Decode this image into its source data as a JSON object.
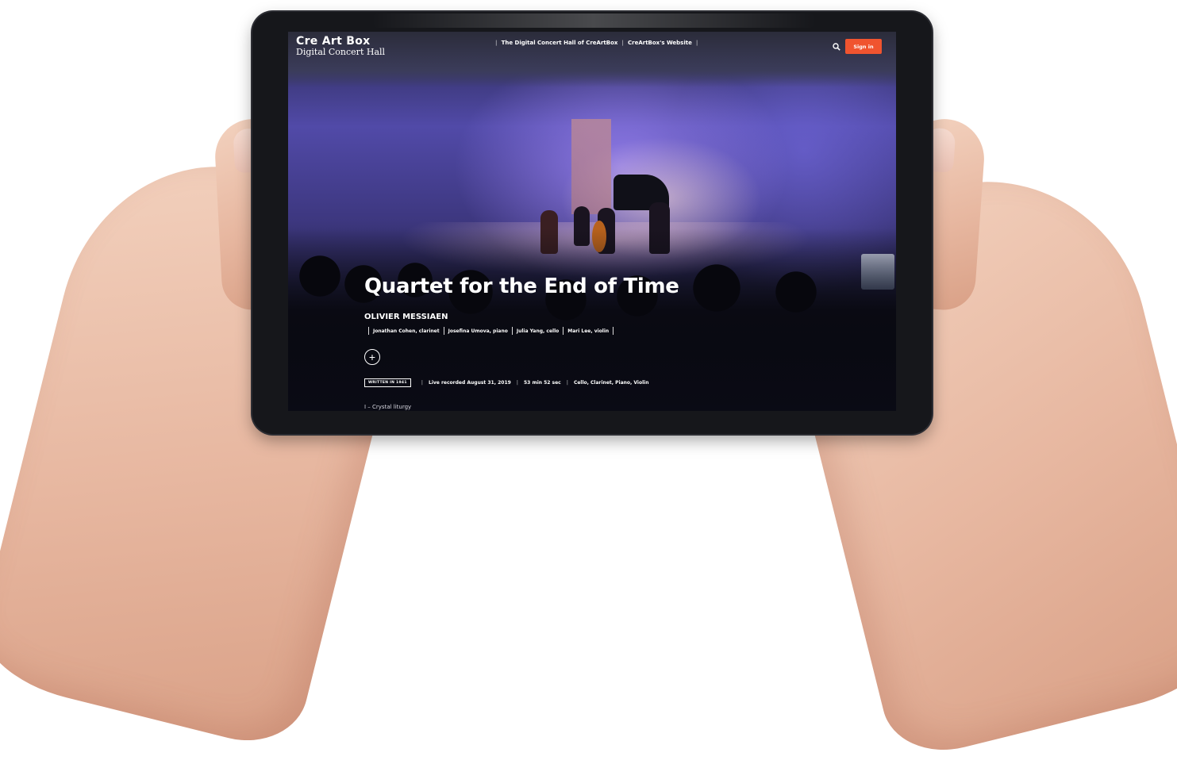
{
  "brand": {
    "line1": "Cre Art Box",
    "line2": "Digital Concert Hall"
  },
  "nav": {
    "items": [
      "The Digital Concert Hall of CreArtBox",
      "CreArtBox's Website"
    ]
  },
  "header": {
    "search_icon": "search-icon",
    "signin_label": "Sign in",
    "signin_color": "#f0542f"
  },
  "program": {
    "title": "Quartet for the End of Time",
    "composer": "OLIVIER MESSIAEN",
    "performers": [
      "Jonathan Cohen, clarinet",
      "Josefina Umova, piano",
      "Julia Yang, cello",
      "Mari Lee, violin"
    ],
    "add_icon": "plus-icon",
    "tag": "WRITTEN IN 1941",
    "recorded": "Live recorded August 31, 2019",
    "duration": "53 min 52 sec",
    "instruments": "Cello, Clarinet, Piano, Violin",
    "movement": "I – Crystal liturgy"
  }
}
